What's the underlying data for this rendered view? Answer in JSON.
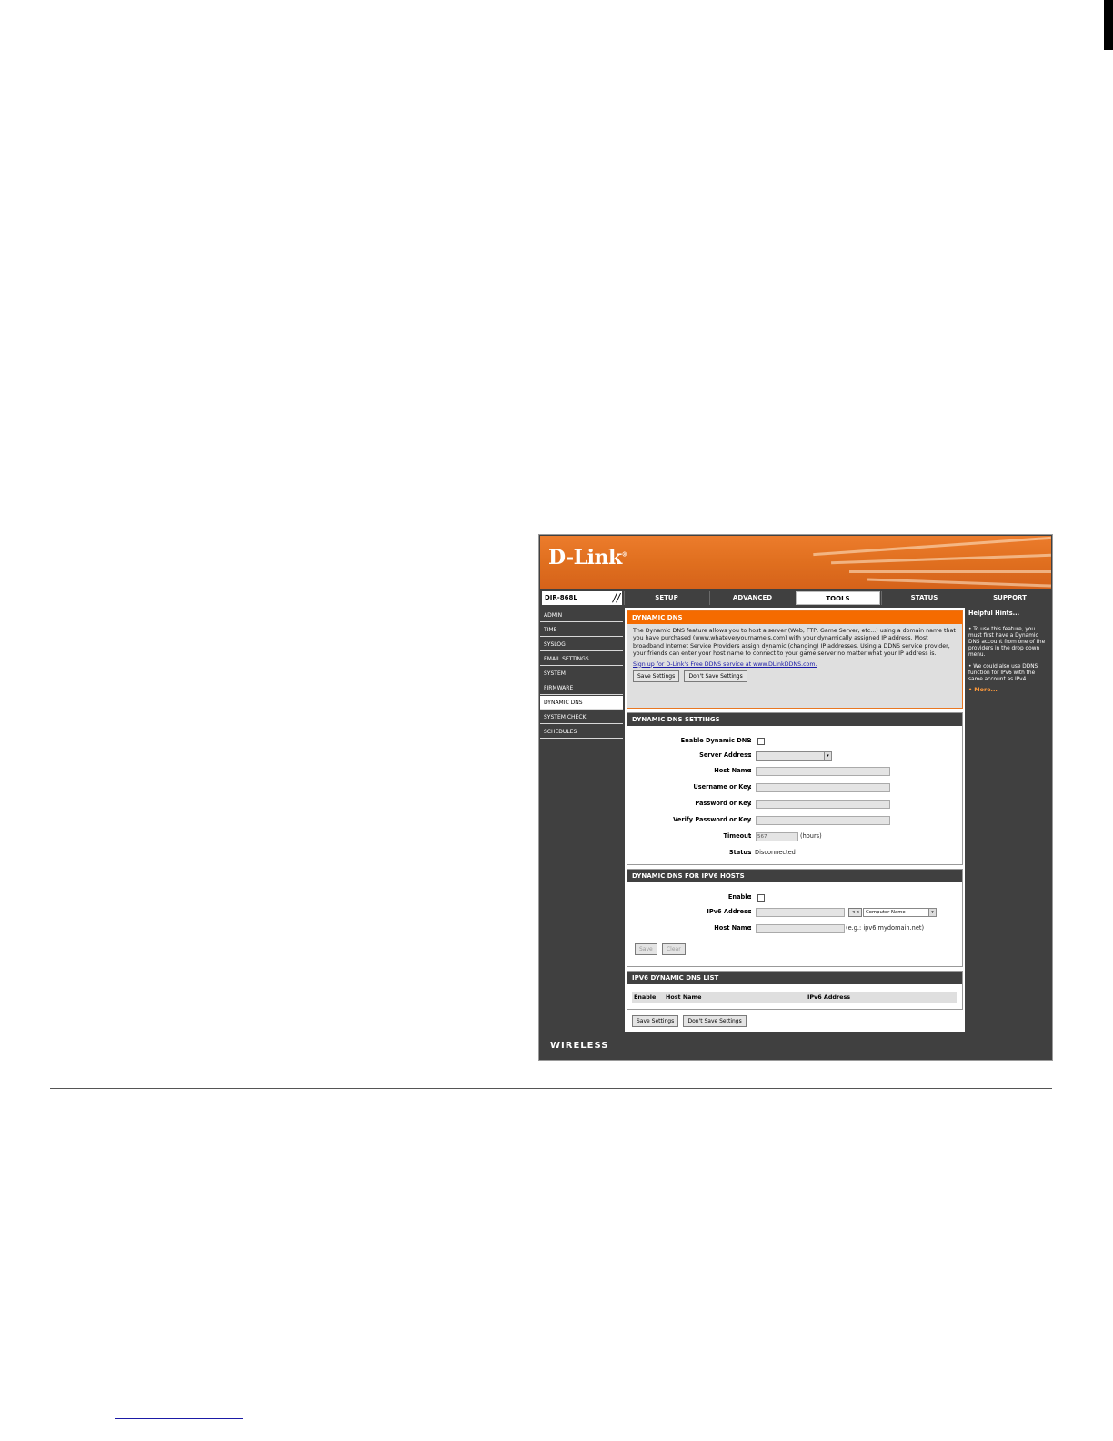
{
  "router": {
    "model": "DIR-868L",
    "brand": "D-Link",
    "tabs": [
      {
        "label": "SETUP",
        "active": false
      },
      {
        "label": "ADVANCED",
        "active": false
      },
      {
        "label": "TOOLS",
        "active": true
      },
      {
        "label": "STATUS",
        "active": false
      },
      {
        "label": "SUPPORT",
        "active": false
      }
    ],
    "sidebar": [
      {
        "label": "ADMIN",
        "active": false
      },
      {
        "label": "TIME",
        "active": false
      },
      {
        "label": "SYSLOG",
        "active": false
      },
      {
        "label": "EMAIL SETTINGS",
        "active": false
      },
      {
        "label": "SYSTEM",
        "active": false
      },
      {
        "label": "FIRMWARE",
        "active": false
      },
      {
        "label": "DYNAMIC DNS",
        "active": true
      },
      {
        "label": "SYSTEM CHECK",
        "active": false
      },
      {
        "label": "SCHEDULES",
        "active": false
      }
    ],
    "intro": {
      "title": "DYNAMIC DNS",
      "text": "The Dynamic DNS feature allows you to host a server (Web, FTP, Game Server, etc...) using a domain name that you have purchased (www.whateveryournameis.com) with your dynamically assigned IP address. Most broadband Internet Service Providers assign dynamic (changing) IP addresses. Using a DDNS service provider, your friends can enter your host name to connect to your game server no matter what your IP address is.",
      "signup_link": "Sign up for D-Link's Free DDNS service at www.DLinkDDNS.com.",
      "save_label": "Save Settings",
      "dont_save_label": "Don't Save Settings"
    },
    "ddns_settings": {
      "title": "DYNAMIC DNS SETTINGS",
      "enable_label": "Enable Dynamic DNS",
      "server_label": "Server Address",
      "host_label": "Host Name",
      "username_label": "Username or Key",
      "password_label": "Password or Key",
      "verify_label": "Verify Password or Key",
      "timeout_label": "Timeout",
      "timeout_value": "567",
      "timeout_unit": "(hours)",
      "status_label": "Status",
      "status_value": "Disconnected"
    },
    "ipv6_hosts": {
      "title": "DYNAMIC DNS FOR IPV6 HOSTS",
      "enable_label": "Enable",
      "address_label": "IPv6 Address",
      "copy_button": "<<",
      "computer_select": "Computer Name",
      "host_label": "Host Name",
      "host_example": "(e.g.: ipv6.mydomain.net)",
      "save_label": "Save",
      "clear_label": "Clear"
    },
    "ipv6_list": {
      "title": "IPV6 DYNAMIC DNS LIST",
      "columns": [
        "Enable",
        "Host Name",
        "IPv6 Address"
      ]
    },
    "bottom_buttons": {
      "save_label": "Save Settings",
      "dont_save_label": "Don't Save Settings"
    },
    "hints": {
      "title": "Helpful Hints...",
      "items": [
        "• To use this feature, you must first have a Dynamic DNS account from one of the providers in the drop down menu.",
        "• We could also use DDNS function for IPv6 with the same account as IPv4."
      ],
      "more": "• More..."
    },
    "footer": "WIRELESS"
  },
  "colors": {
    "accent_orange": "#f56b00",
    "nav_dark": "#404040"
  }
}
